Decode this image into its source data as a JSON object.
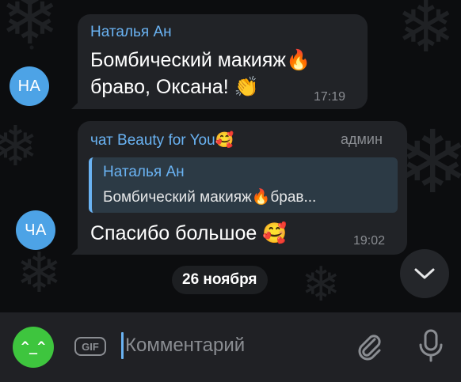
{
  "messages": [
    {
      "avatar_initials": "НА",
      "sender": "Наталья Ан",
      "text": "Бомбический макияж🔥 браво, Оксана! 👏",
      "text_line1": "Бомбический макияж",
      "text_line1_emoji": "🔥",
      "text_line2": "браво, Оксана!",
      "text_line2_emoji": "👏",
      "time": "17:19"
    },
    {
      "avatar_initials": "ЧА",
      "sender": "чат Beauty for You",
      "sender_emoji": "🥰",
      "role": "админ",
      "reply": {
        "sender": "Наталья Ан",
        "text": "Бомбический макияж🔥брав..."
      },
      "text": "Спасибо большое",
      "text_emoji": "🥰",
      "time": "19:02"
    }
  ],
  "date_separator": "26 ноября",
  "input": {
    "placeholder": "Комментарий",
    "gif_label": "GIF",
    "emoji_button_face": "^_^"
  },
  "icons": {
    "scroll_down": "chevron-down-icon",
    "attach": "paperclip-icon",
    "voice": "microphone-icon"
  },
  "colors": {
    "accent": "#6ab3f3",
    "avatar": "#4da3e6",
    "emoji_button": "#3ec53e",
    "bubble": "#212327"
  }
}
